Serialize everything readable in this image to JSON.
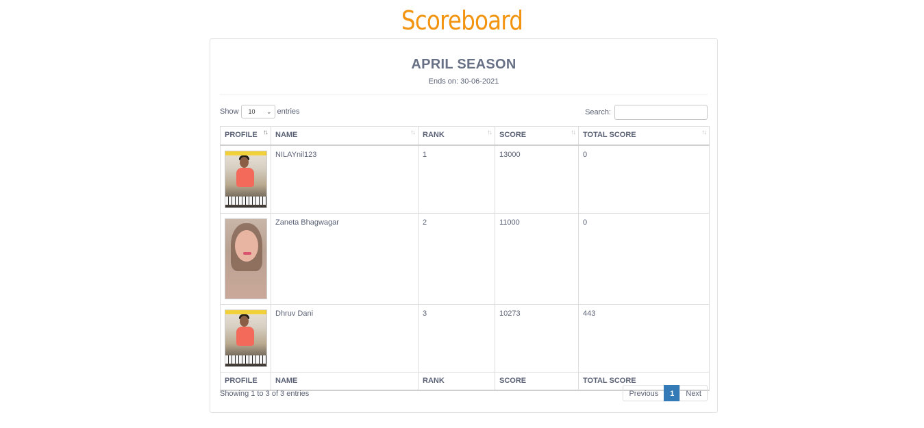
{
  "header": {
    "title": "Scoreboard"
  },
  "season": {
    "name": "APRIL SEASON",
    "ends_on": "Ends on: 30-06-2021"
  },
  "controls": {
    "show_label": "Show",
    "page_length": "10",
    "entries_label": "entries",
    "search_label": "Search:",
    "search_value": ""
  },
  "table": {
    "columns": [
      "PROFILE",
      "NAME",
      "RANK",
      "SCORE",
      "TOTAL SCORE"
    ],
    "rows": [
      {
        "name": "NILAYnil123",
        "rank": "1",
        "score": "13000",
        "total_score": "0",
        "avatar": "boy-keyboard-photo"
      },
      {
        "name": "Zaneta Bhagwagar",
        "rank": "2",
        "score": "11000",
        "total_score": "0",
        "avatar": "girl-selfie-photo"
      },
      {
        "name": "Dhruv Dani",
        "rank": "3",
        "score": "10273",
        "total_score": "443",
        "avatar": "boy-keyboard-photo"
      }
    ]
  },
  "footer": {
    "info": "Showing 1 to 3 of 3 entries",
    "previous": "Previous",
    "current_page": "1",
    "next": "Next"
  },
  "colors": {
    "title": "#f39410",
    "pager_active": "#337ab7",
    "text": "#5a6175"
  }
}
